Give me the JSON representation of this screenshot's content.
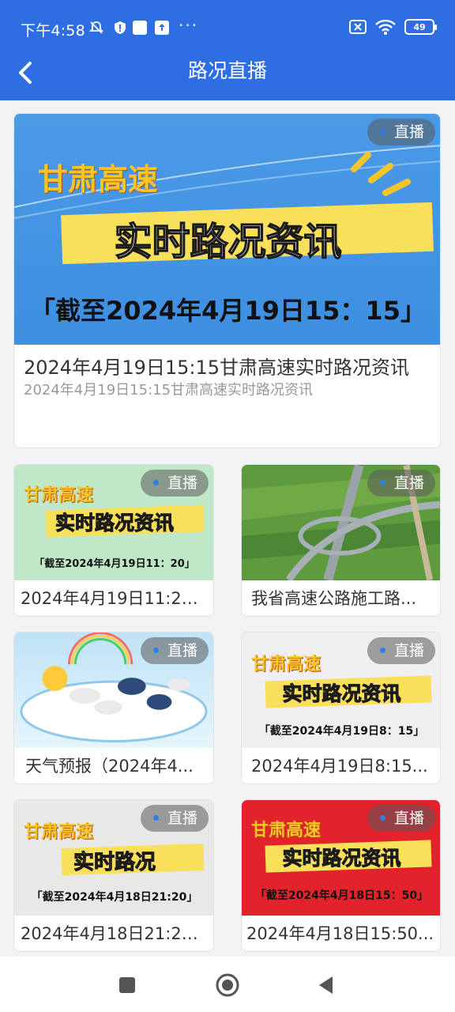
{
  "status_bar": {
    "time": "下午4:58",
    "icons": [
      "mute-icon",
      "shield-icon",
      "square-icon",
      "upload-icon"
    ],
    "dots": "···",
    "battery": "49",
    "right_icons": [
      "sim-off-icon",
      "wifi-icon"
    ]
  },
  "nav": {
    "title": "路况直播",
    "back_icon": "chevron-left-icon"
  },
  "featured": {
    "badge": "直播",
    "title": "2024年4月19日15:15甘肃高速实时路况资讯",
    "subtitle": "2024年4月19日15:15甘肃高速实时路况资讯",
    "art": {
      "brand": "甘肃高速",
      "main": "实时路况资讯",
      "date": "「截至2024年4月19日15：15」"
    }
  },
  "grid": [
    {
      "badge": "直播",
      "title": "2024年4月19日11:20...",
      "art": {
        "type": "banner",
        "brand": "甘肃高速",
        "main": "实时路况资讯",
        "date": "「截至2024年4月19日11：20」",
        "bg": "#bfe8c8"
      }
    },
    {
      "badge": "直播",
      "title": "我省高速公路施工路...",
      "art": {
        "type": "photo"
      }
    },
    {
      "badge": "直播",
      "title": "天气预报（2024年4...",
      "art": {
        "type": "weather"
      }
    },
    {
      "badge": "直播",
      "title": "2024年4月19日8:15...",
      "art": {
        "type": "banner",
        "brand": "甘肃高速",
        "main": "实时路况资讯",
        "date": "「截至2024年4月19日8：15」",
        "bg": "#efeff1"
      }
    },
    {
      "badge": "直播",
      "title": "2024年4月18日21:20...",
      "art": {
        "type": "banner",
        "brand": "甘肃高速",
        "main": "实时路况",
        "date": "「截至2024年4月18日21:20」",
        "bg": "#e8e8e6"
      }
    },
    {
      "badge": "直播",
      "title": "2024年4月18日15:50...",
      "art": {
        "type": "banner",
        "brand": "甘肃高速",
        "main": "实时路况资讯",
        "date": "「截至2024年4月18日15：50」",
        "bg": "#e2232b"
      }
    }
  ],
  "system_nav": {
    "icons": [
      "recent-apps-icon",
      "home-icon",
      "back-icon"
    ]
  },
  "colors": {
    "accent": "#2f6de2",
    "background": "#f2f3f5",
    "live_dot": "#2f7ee8"
  }
}
